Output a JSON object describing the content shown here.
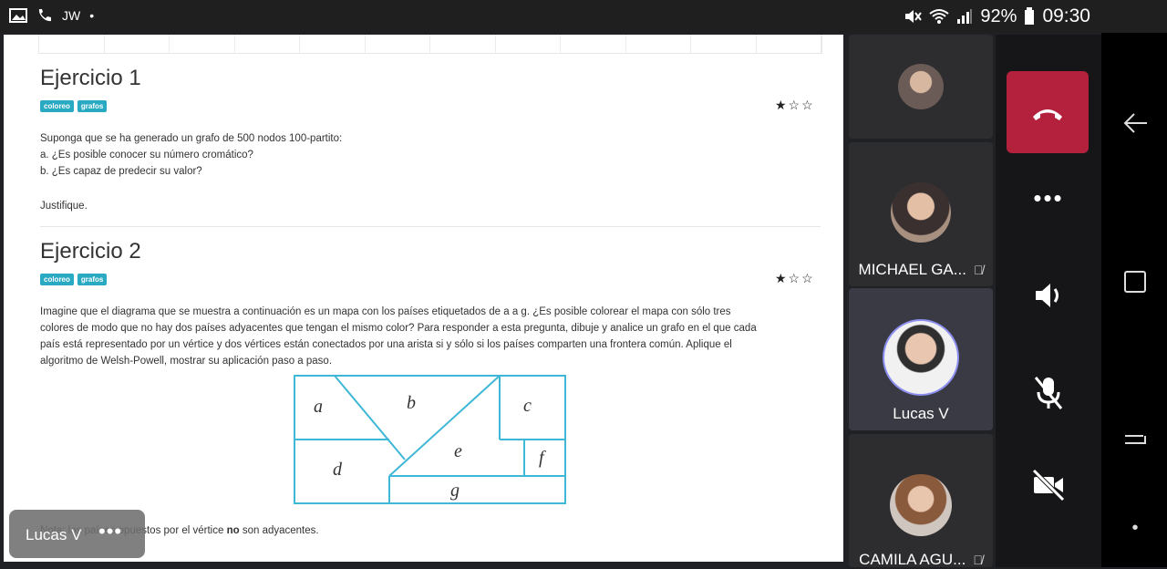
{
  "status_bar": {
    "left_text": "JW",
    "battery": "92%",
    "time": "09:30",
    "icons": [
      "gallery-icon",
      "phone-icon",
      "dot-icon",
      "mute-icon",
      "wifi-icon",
      "signal-icon",
      "battery-icon"
    ]
  },
  "document": {
    "ex1": {
      "title": "Ejercicio 1",
      "tags": [
        "coloreo",
        "grafos"
      ],
      "rating": "★☆☆",
      "lines": [
        "Suponga que se ha generado un grafo de 500 nodos 100-partito:",
        "a. ¿Es posible conocer su número cromático?",
        "b. ¿Es capaz de predecir su valor?",
        "Justifique."
      ]
    },
    "ex2": {
      "title": "Ejercicio 2",
      "tags": [
        "coloreo",
        "grafos"
      ],
      "rating": "★☆☆",
      "lines": [
        "Imagine que el diagrama que se muestra a continuación es un mapa con los países etiquetados de a a g. ¿Es posible colorear el mapa con sólo tres",
        "colores de modo que no hay dos países adyacentes que tengan el mismo color? Para responder a esta pregunta, dibuje y analice un grafo en el que cada",
        "país está representado por un vértice y dos vértices están conectados por una arista si y sólo si los países comparten una frontera común. Aplique el",
        "algoritmo de Welsh-Powell, mostrar su aplicación paso a paso."
      ],
      "map_labels": [
        "a",
        "b",
        "c",
        "d",
        "e",
        "f",
        "g"
      ],
      "note_prefix": "Nota: los países opuestos por el vértice",
      "note_bold": "no",
      "note_suffix": "son adyacentes."
    }
  },
  "participants": [
    {
      "name": "",
      "muted": false
    },
    {
      "name": "MICHAEL GA...",
      "muted": true
    },
    {
      "name": "Lucas V",
      "muted": false,
      "active": true
    },
    {
      "name": "CAMILA AGU...",
      "muted": true
    }
  ],
  "controls": {
    "hangup": "hang-up",
    "more": "•••",
    "speaker": "speaker",
    "mic": "mic-off",
    "camera": "camera-off"
  },
  "toast": {
    "name": "Lucas V",
    "more": "•••"
  },
  "colors": {
    "accent": "#b3213d",
    "tag": "#2aa9c3",
    "map_line": "#3fb7d6"
  }
}
